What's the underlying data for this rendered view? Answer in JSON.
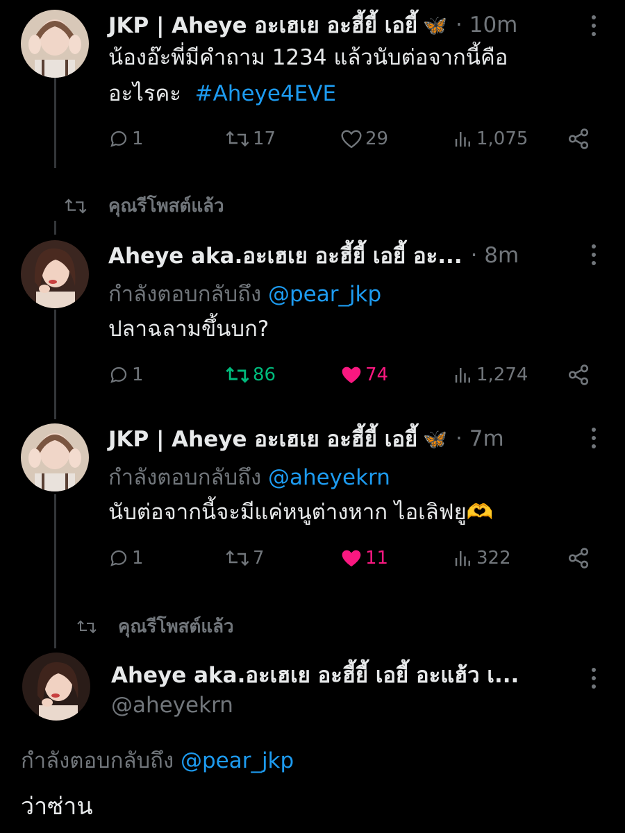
{
  "tweets": [
    {
      "name": "JKP | Aheye อะเฮเย อะฮี้ยี้ เอยี้",
      "emoji": "🦋",
      "time": "· 10m",
      "text": "น้องอ๊ะพี่มีคำถาม  1234 แล้วนับต่อจากนี้คือ",
      "text_line2": "อะไรคะ",
      "hashtag": "#Aheye4EVE",
      "replies": "1",
      "reposts": "17",
      "likes": "29",
      "views": "1,075"
    },
    {
      "repost_label": "คุณรีโพสต์แล้ว",
      "name": "Aheye aka.อะเฮเย อะฮี้ยี้ เอยี้ อะ...",
      "time": "· 8m",
      "reply_prefix": "กำลังตอบกลับถึง",
      "reply_mention": "@pear_jkp",
      "text": "ปลาฉลามขึ้นบก?",
      "replies": "1",
      "reposts": "86",
      "likes": "74",
      "views": "1,274"
    },
    {
      "name": "JKP | Aheye อะเฮเย อะฮี้ยี้ เอยี้",
      "emoji": "🦋",
      "time": "· 7m",
      "reply_prefix": "กำลังตอบกลับถึง",
      "reply_mention": "@aheyekrn",
      "text": "นับต่อจากนี้จะมีแค่หนูต่างหาก ไอเลิฟยู🫶",
      "replies": "1",
      "reposts": "7",
      "likes": "11",
      "views": "322"
    },
    {
      "repost_label": "คุณรีโพสต์แล้ว",
      "name": "Aheye aka.อะเฮเย อะฮี้ยี้ เอยี้ อะแฮ้ว เ...",
      "handle": "@aheyekrn",
      "reply_prefix": "กำลังตอบกลับถึง",
      "reply_mention": "@pear_jkp",
      "text": "ว่าซ่าน"
    }
  ],
  "colors": {
    "background": "#000000",
    "text": "#e7e9ea",
    "muted": "#71767b",
    "link": "#1d9bf0",
    "repost_active": "#00ba7c",
    "like_active": "#f91880"
  },
  "icons": [
    "reply-icon",
    "repost-icon",
    "heart-icon",
    "views-icon",
    "share-icon",
    "more-icon"
  ]
}
